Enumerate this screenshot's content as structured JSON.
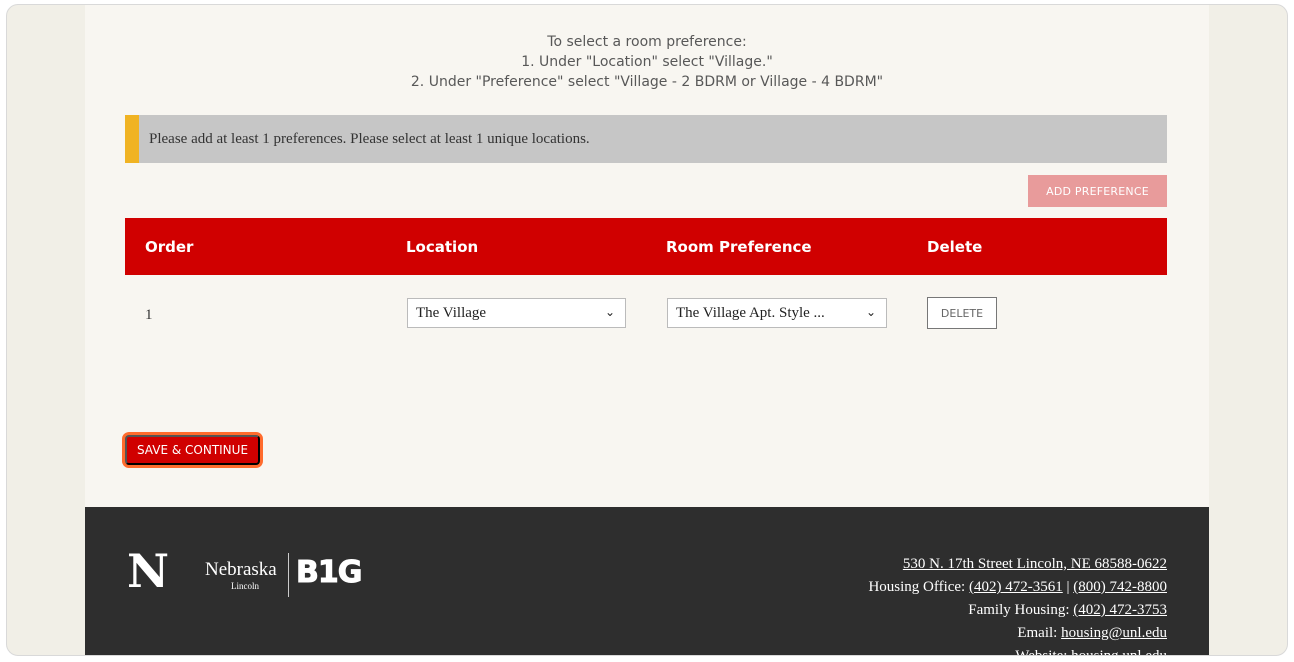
{
  "instructions": {
    "line1": "To select a room preference:",
    "line2": "1. Under \"Location\" select \"Village.\"",
    "line3": "2. Under \"Preference\" select \"Village - 2 BDRM or Village - 4 BDRM\""
  },
  "alert": {
    "message": "Please add at least 1 preferences. Please select at least 1 unique locations."
  },
  "add_preference_label": "ADD PREFERENCE",
  "table": {
    "headers": [
      "Order",
      "Location",
      "Room Preference",
      "Delete"
    ],
    "rows": [
      {
        "order": "1",
        "location": "The Village",
        "room_preference": "The Village Apt. Style ...",
        "delete_label": "DELETE"
      }
    ]
  },
  "save_continue_label": "SAVE & CONTINUE",
  "footer": {
    "logo_n": "N",
    "logo_nebraska": "Nebraska",
    "logo_lincoln": "Lincoln",
    "logo_big": "B1G",
    "address": "530 N. 17th Street Lincoln, NE 68588-0622",
    "housing_office_label": "Housing Office:",
    "housing_phone_1": "(402) 472-3561",
    "separator": "|",
    "housing_phone_2": "(800) 742-8800",
    "family_housing_label": "Family Housing:",
    "family_phone": "(402) 472-3753",
    "email_label": "Email:",
    "email": "housing@unl.edu",
    "website_label": "Website:",
    "website": "housing.unl.edu"
  },
  "colors": {
    "brand_red": "#d00000",
    "alert_accent": "#f0b323",
    "alert_bg": "#c6c6c6",
    "footer_bg": "#2e2e2e"
  }
}
